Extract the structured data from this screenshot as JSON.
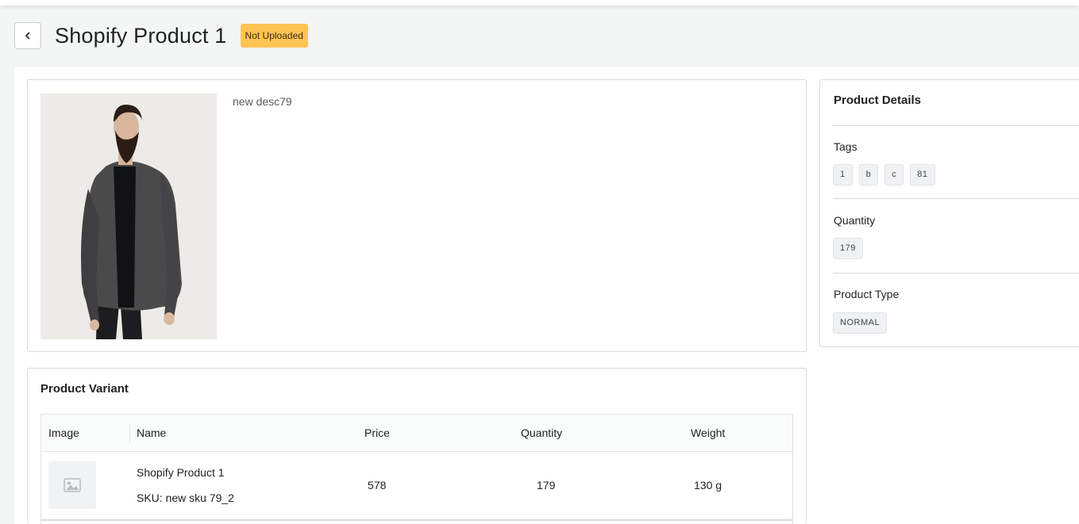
{
  "header": {
    "title": "Shopify Product 1",
    "status": "Not Uploaded",
    "back_icon": "chevron-left-icon"
  },
  "product": {
    "description": "new desc79"
  },
  "details": {
    "title": "Product Details",
    "tags_label": "Tags",
    "tags": [
      "1",
      "b",
      "c",
      "81"
    ],
    "quantity_label": "Quantity",
    "quantity": "179",
    "type_label": "Product Type",
    "type": "NORMAL"
  },
  "variants": {
    "title": "Product Variant",
    "columns": [
      "Image",
      "Name",
      "Price",
      "Quantity",
      "Weight"
    ],
    "rows": [
      {
        "image_icon": "image-placeholder-icon",
        "name": "Shopify Product 1",
        "sku": "SKU: new sku 79_2",
        "price": "578",
        "quantity": "179",
        "weight": "130 g"
      }
    ]
  },
  "colors": {
    "badge": "#ffc453",
    "page_bg": "#f4f5f5",
    "border": "#d9dadc"
  }
}
